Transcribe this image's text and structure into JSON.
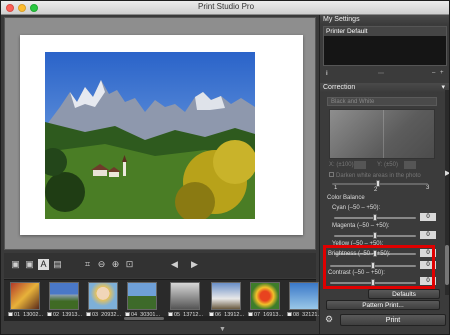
{
  "window": {
    "title": "Print Studio Pro"
  },
  "thumbnails": [
    {
      "label": "01_13002..."
    },
    {
      "label": "02_13913..."
    },
    {
      "label": "03_20932..."
    },
    {
      "label": "04_30301..."
    },
    {
      "label": "05_13712..."
    },
    {
      "label": "06_13912..."
    },
    {
      "label": "07_16913..."
    },
    {
      "label": "08_32121..."
    }
  ],
  "right_panel": {
    "my_settings": {
      "header": "My Settings",
      "items": [
        "Printer Default"
      ]
    },
    "info_label": "i",
    "correction": {
      "header": "Correction",
      "mode_select": "Black and White",
      "x_label": "X: (±100)",
      "y_label": "Y: (±50)",
      "darken_label": "Darken white areas in the photo",
      "scale_1": "1",
      "scale_2": "2",
      "scale_3": "3",
      "color_balance": "Color Balance",
      "cyan": {
        "label": "Cyan (–50 – +50):",
        "value": "0"
      },
      "magenta": {
        "label": "Magenta (–50 – +50):",
        "value": "0"
      },
      "yellow": {
        "label": "Yellow (–50 – +50):",
        "value": "0"
      },
      "brightness": {
        "label": "Brightness (–50 – +50):",
        "value": "0"
      },
      "contrast": {
        "label": "Contrast (–50 – +50):",
        "value": "0"
      }
    },
    "defaults_button": "Defaults",
    "pattern_print_button": "Pattern Print...",
    "print_button": "Print"
  },
  "colors": {
    "highlight": "#e00000",
    "panel_bg": "#3b3b3b"
  }
}
